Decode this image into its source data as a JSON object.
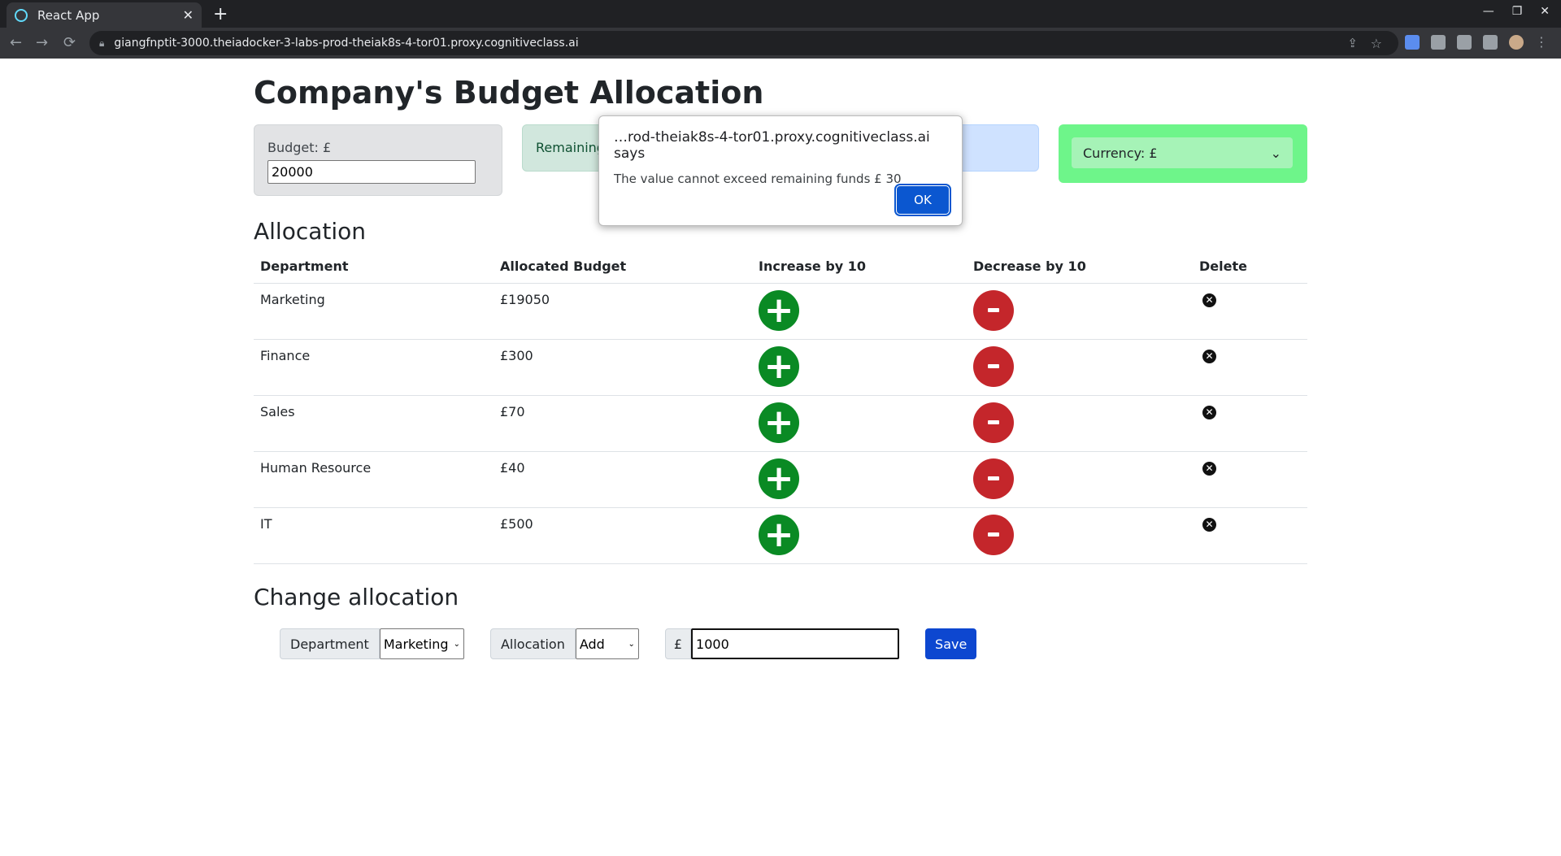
{
  "browser": {
    "tab_title": "React App",
    "tab_close": "✕",
    "new_tab": "+",
    "url": "giangfnptit-3000.theiadocker-3-labs-prod-theiak8s-4-tor01.proxy.cognitiveclass.ai",
    "back": "←",
    "forward": "→",
    "reload": "⟳",
    "min": "—",
    "restore": "❐",
    "close": "✕",
    "menu": "⋮"
  },
  "page": {
    "title": "Company's Budget Allocation",
    "budget_label": "Budget: £",
    "budget_value": "20000",
    "remaining_label": "Remaining",
    "currency_label": "Currency: £",
    "currency_chevron": "⌄"
  },
  "allocation": {
    "heading": "Allocation",
    "columns": [
      "Department",
      "Allocated Budget",
      "Increase by 10",
      "Decrease by 10",
      "Delete"
    ],
    "rows": [
      {
        "department": "Marketing",
        "budget": "£19050"
      },
      {
        "department": "Finance",
        "budget": "£300"
      },
      {
        "department": "Sales",
        "budget": "£70"
      },
      {
        "department": "Human Resource",
        "budget": "£40"
      },
      {
        "department": "IT",
        "budget": "£500"
      }
    ],
    "plus_symbol": "+",
    "delete_symbol": "✕"
  },
  "change": {
    "heading": "Change allocation",
    "department_label": "Department",
    "department_value": "Marketing",
    "allocation_label": "Allocation",
    "allocation_value": "Add",
    "currency_symbol": "£",
    "amount_value": "1000",
    "save_label": "Save",
    "chevron": "⌄"
  },
  "dialog": {
    "title": "…rod-theiak8s-4-tor01.proxy.cognitiveclass.ai says",
    "message": "The value cannot exceed remaining funds £ 30",
    "ok_label": "OK"
  }
}
